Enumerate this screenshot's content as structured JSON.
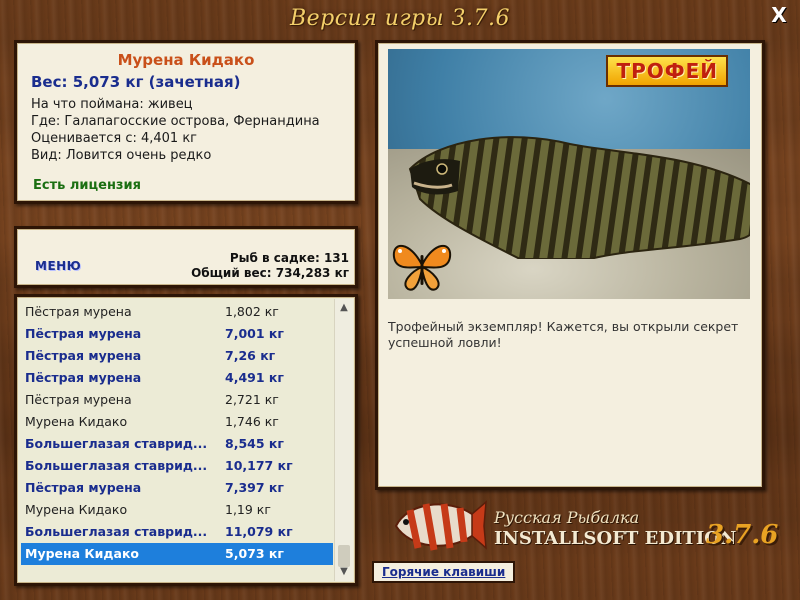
{
  "header": {
    "title": "Версия игры 3.7.6",
    "close_label": "X"
  },
  "info": {
    "fish_name": "Мурена Кидако",
    "weight": "Вес: 5,073 кг (зачетная)",
    "bait": "На что поймана: живец",
    "location": "Где: Галапагосские острова, Фернандина",
    "rated_from": "Оценивается с: 4,401 кг",
    "rarity": "Вид: Ловится очень редко",
    "license": "Есть лицензия"
  },
  "menu": {
    "menu_label": "МЕНЮ",
    "fish_in_keepnet": "Рыб в садке: 131",
    "total_weight": "Общий вес: 734,283 кг"
  },
  "catch_list": [
    {
      "name": "Пёстрая мурена",
      "weight": "1,802 кг",
      "style": "plain"
    },
    {
      "name": "Пёстрая мурена",
      "weight": "7,001 кг",
      "style": "bold"
    },
    {
      "name": "Пёстрая мурена",
      "weight": "7,26 кг",
      "style": "bold"
    },
    {
      "name": "Пёстрая мурена",
      "weight": "4,491 кг",
      "style": "bold"
    },
    {
      "name": "Пёстрая мурена",
      "weight": "2,721 кг",
      "style": "plain"
    },
    {
      "name": "Мурена Кидако",
      "weight": "1,746 кг",
      "style": "plain"
    },
    {
      "name": "Большеглазая ставрид...",
      "weight": "8,545 кг",
      "style": "bold"
    },
    {
      "name": "Большеглазая ставрид...",
      "weight": "10,177 кг",
      "style": "bold"
    },
    {
      "name": "Пёстрая мурена",
      "weight": "7,397 кг",
      "style": "bold"
    },
    {
      "name": "Мурена Кидако",
      "weight": "1,19 кг",
      "style": "plain"
    },
    {
      "name": "Большеглазая ставрид...",
      "weight": "11,079 кг",
      "style": "bold"
    },
    {
      "name": "Мурена Кидако",
      "weight": "5,073 кг",
      "style": "selected"
    }
  ],
  "photo": {
    "trophy_badge": "ТРОФЕЙ",
    "description": "Трофейный экземпляр! Кажется, вы открыли секрет успешной ловли!"
  },
  "logo": {
    "line1": "Русская Рыбалка",
    "line2": "INSTALLSOFT EDITION",
    "version": "3.7.6"
  },
  "footer": {
    "hotkeys_label": "Горячие клавиши"
  },
  "colors": {
    "fish_name": "#c9501a",
    "weight": "#1a2d8e",
    "license": "#1b6f12",
    "selection": "#1e7fdc"
  }
}
